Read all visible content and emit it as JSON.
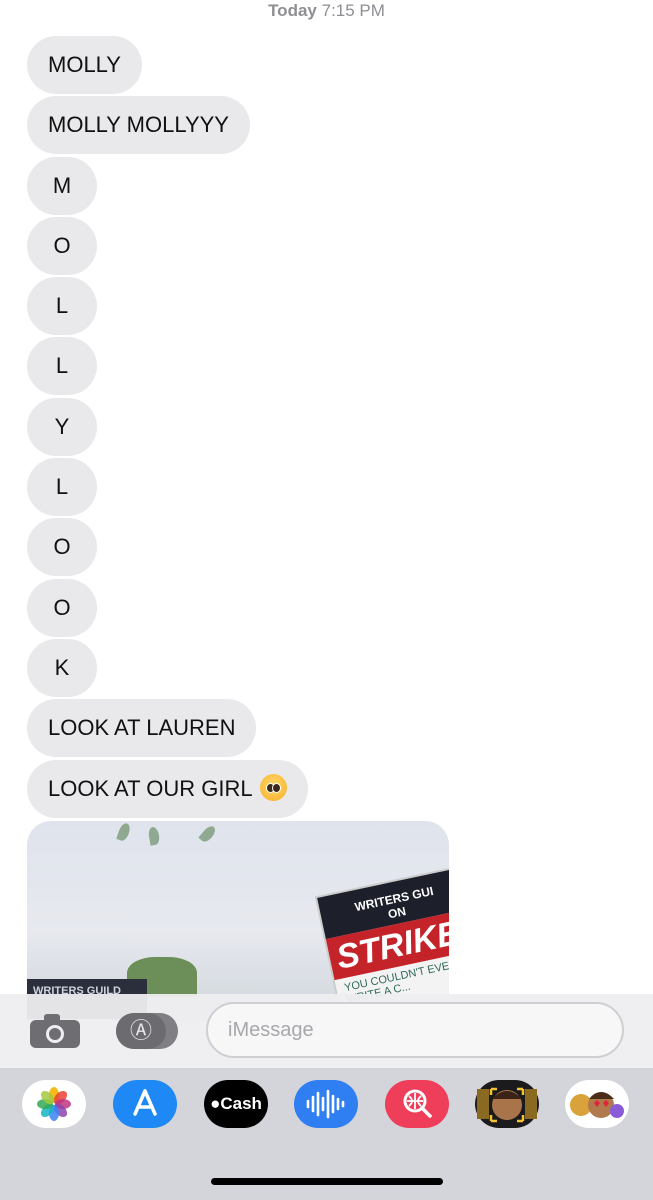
{
  "header": {
    "day": "Today",
    "time": "7:15 PM"
  },
  "messages": [
    "MOLLY",
    "MOLLY MOLLYYY",
    "M",
    "O",
    "L",
    "L",
    "Y",
    "L",
    "O",
    "O",
    "K",
    "LOOK AT LAUREN",
    "LOOK AT OUR GIRL"
  ],
  "photo_sign": {
    "top": "WRITERS GUI",
    "on": "ON",
    "strike": "STRIKE!",
    "handwritten": "YOU COULDN'T EVEN WRITE A C...",
    "second_sign": "WRITERS GUILD"
  },
  "input": {
    "placeholder": "iMessage"
  },
  "app_drawer": [
    {
      "name": "photos-icon"
    },
    {
      "name": "app-store-icon"
    },
    {
      "name": "apple-cash-icon",
      "label": "Cash"
    },
    {
      "name": "audio-message-icon"
    },
    {
      "name": "image-search-icon"
    },
    {
      "name": "memoji-icon"
    },
    {
      "name": "memoji-stickers-icon"
    }
  ],
  "colors": {
    "bubble_bg": "#e9e9eb",
    "timestamp": "#8e8e93",
    "drawer_bg": "#d3d5da"
  }
}
